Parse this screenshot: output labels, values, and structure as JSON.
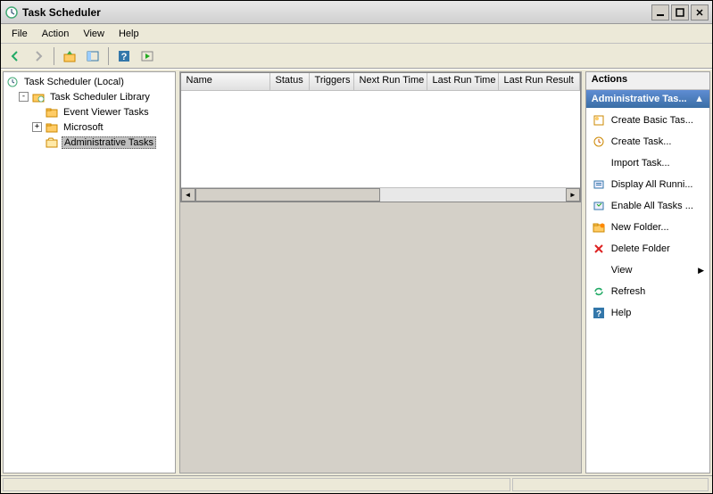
{
  "window": {
    "title": "Task Scheduler"
  },
  "menu": {
    "file": "File",
    "action": "Action",
    "view": "View",
    "help": "Help"
  },
  "tree": {
    "root": "Task Scheduler (Local)",
    "library": "Task Scheduler Library",
    "event_viewer": "Event Viewer Tasks",
    "microsoft": "Microsoft",
    "admin_tasks": "Administrative Tasks"
  },
  "columns": {
    "name": "Name",
    "status": "Status",
    "triggers": "Triggers",
    "next_run": "Next Run Time",
    "last_run": "Last Run Time",
    "last_result": "Last Run Result"
  },
  "actions": {
    "header": "Actions",
    "subheader": "Administrative Tas...",
    "create_basic": "Create Basic Tas...",
    "create_task": "Create Task...",
    "import_task": "Import Task...",
    "display_running": "Display All Runni...",
    "enable_history": "Enable All Tasks ...",
    "new_folder": "New Folder...",
    "delete_folder": "Delete Folder",
    "view": "View",
    "refresh": "Refresh",
    "help": "Help"
  }
}
